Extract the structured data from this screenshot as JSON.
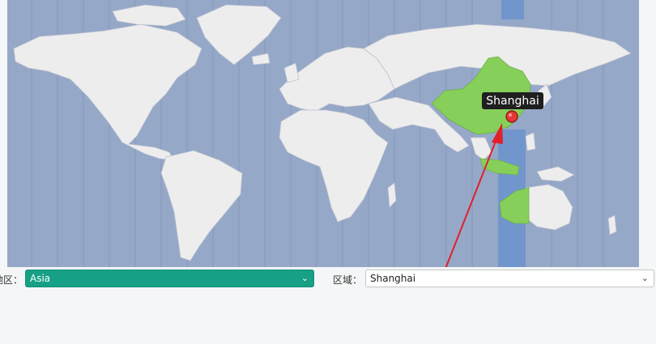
{
  "map": {
    "selected_city": "Shanghai",
    "colors": {
      "ocean": "#96a8c8",
      "land": "#eeeded",
      "highlight_land": "#86cf5a",
      "timezone_band": "#7196cc",
      "pin": "#e53935",
      "arrow": "#e0202a"
    }
  },
  "controls": {
    "region_label": "地区：",
    "region_value": "Asia",
    "zone_label": "区域：",
    "zone_value": "Shanghai",
    "chevron": "⌄"
  }
}
